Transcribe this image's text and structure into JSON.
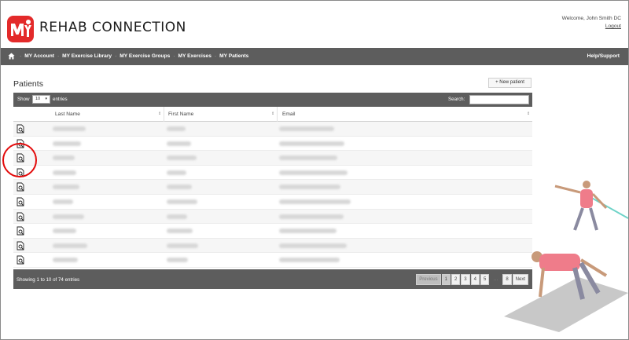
{
  "header": {
    "logo_mark": "MY",
    "brand": "REHAB CONNECTION",
    "welcome": "Welcome, John Smith DC",
    "logout": "Logout"
  },
  "nav": {
    "home_icon": "home-icon",
    "items": [
      "MY Account",
      "MY Exercise Library",
      "MY Exercise Groups",
      "MY Exercises",
      "MY Patients"
    ],
    "separator": "·",
    "help": "Help/Support"
  },
  "page": {
    "title": "Patients",
    "new_button": "+ New patient"
  },
  "table": {
    "show_label": "Show",
    "page_size": "10",
    "entries_label": "entries",
    "search_label": "Search:",
    "search_value": "",
    "columns": [
      "",
      "Last Name",
      "First Name",
      "Email"
    ],
    "rows": [
      {
        "icon": "view-patient-icon"
      },
      {
        "icon": "view-patient-icon"
      },
      {
        "icon": "view-patient-icon"
      },
      {
        "icon": "view-patient-icon"
      },
      {
        "icon": "view-patient-icon"
      },
      {
        "icon": "view-patient-icon"
      },
      {
        "icon": "view-patient-icon"
      },
      {
        "icon": "view-patient-icon"
      },
      {
        "icon": "view-patient-icon"
      },
      {
        "icon": "view-patient-icon"
      }
    ],
    "info": "Showing 1 to 10 of 74 entries",
    "pagination": {
      "previous": "Previous",
      "pages": [
        "1",
        "2",
        "3",
        "4",
        "5"
      ],
      "ellipsis": "…",
      "last": "8",
      "next": "Next",
      "current": "1"
    }
  },
  "colors": {
    "brand_red": "#e32a2a",
    "bar_gray": "#5d5d5d",
    "highlight_red": "#e30b0b"
  }
}
